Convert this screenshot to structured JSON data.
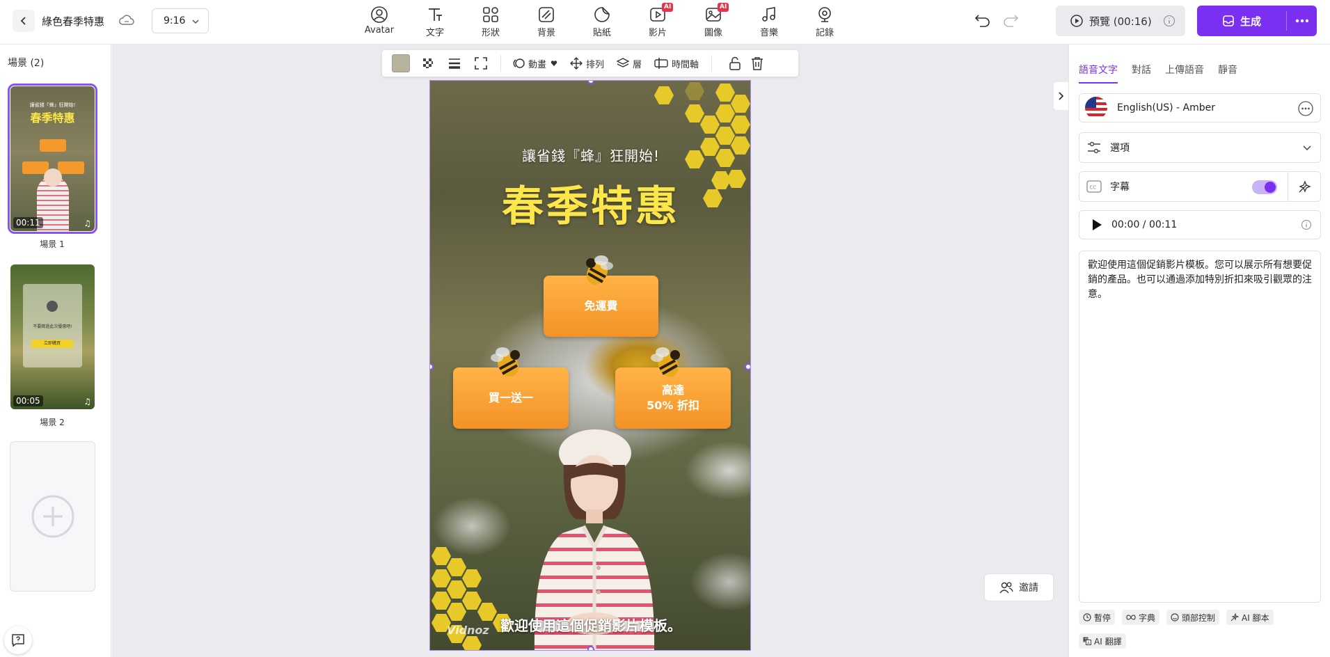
{
  "header": {
    "project_title": "綠色春季特惠",
    "aspect_ratio": "9:16",
    "tools": [
      {
        "label": "Avatar",
        "icon": "avatar-icon",
        "ai": false
      },
      {
        "label": "文字",
        "icon": "text-icon",
        "ai": false
      },
      {
        "label": "形狀",
        "icon": "shapes-icon",
        "ai": false
      },
      {
        "label": "背景",
        "icon": "background-icon",
        "ai": false
      },
      {
        "label": "貼紙",
        "icon": "sticker-icon",
        "ai": false
      },
      {
        "label": "影片",
        "icon": "video-icon",
        "ai": true
      },
      {
        "label": "圖像",
        "icon": "image-icon",
        "ai": true
      },
      {
        "label": "音樂",
        "icon": "music-icon",
        "ai": false
      },
      {
        "label": "記錄",
        "icon": "record-icon",
        "ai": false
      }
    ],
    "ai_badge": "AI",
    "preview_label": "預覽 (00:16)",
    "generate_label": "生成"
  },
  "scenes": {
    "title": "場景 (2)",
    "items": [
      {
        "label": "場景 1",
        "duration": "00:11",
        "selected": true
      },
      {
        "label": "場景 2",
        "duration": "00:05",
        "selected": false
      }
    ]
  },
  "element_toolbar": {
    "swatch_color": "#b7b39e",
    "animation_label": "動畫",
    "arrange_label": "排列",
    "layer_label": "層",
    "timeline_label": "時間軸"
  },
  "video": {
    "subtitle": "讓省錢『蜂』狂開始!",
    "title": "春季特惠",
    "card_free_shipping": "免運費",
    "card_bogo": "買一送一",
    "card_discount_line1": "高達",
    "card_discount_line2": "50% 折扣",
    "caption": "歡迎使用這個促銷影片模板。",
    "watermark": "Vidnoz"
  },
  "thumb2": {
    "text1": "不要錯過此次優惠吧!",
    "button": "立即購買"
  },
  "invite_label": "邀請",
  "right_panel": {
    "tabs": [
      "語音文字",
      "對話",
      "上傳語音",
      "靜音"
    ],
    "voice": "English(US) - Amber",
    "options_label": "選項",
    "subtitles_label": "字幕",
    "time_display": "00:00 / 00:11",
    "script": "歡迎使用這個促銷影片模板。您可以展示所有想要促銷的產品。也可以通過添加特別折扣來吸引觀眾的注意。",
    "chips": [
      {
        "label": "暫停",
        "icon": "clock-icon"
      },
      {
        "label": "字典",
        "icon": "infinity-icon"
      },
      {
        "label": "頭部控制",
        "icon": "face-icon"
      },
      {
        "label": "AI 腳本",
        "icon": "magic-icon"
      },
      {
        "label": "AI 翻譯",
        "icon": "translate-icon"
      }
    ]
  },
  "colors": {
    "accent": "#7b2ff0",
    "title_yellow": "#fde64a",
    "card_orange": "#f49226"
  }
}
